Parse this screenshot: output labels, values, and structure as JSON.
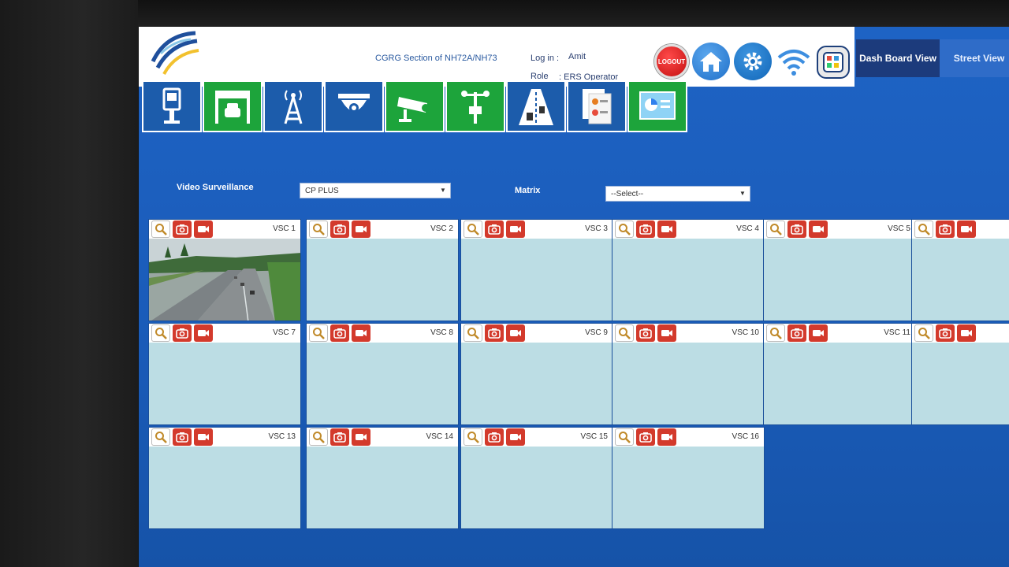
{
  "header": {
    "section_title": "CGRG Section of NH72A/NH73",
    "login_label": "Log in :",
    "login_value": "Amit",
    "role_label": "Role",
    "role_value": ": ERS Operator",
    "logout_label": "LOGOUT",
    "tabs": [
      {
        "label": "Dash Board View",
        "active": true
      },
      {
        "label": "Street View",
        "active": false
      }
    ]
  },
  "toolbar": {
    "items": [
      {
        "icon": "kiosk-icon",
        "color": "blue"
      },
      {
        "icon": "toll-gate-car-icon",
        "color": "green"
      },
      {
        "icon": "radio-tower-icon",
        "color": "blue"
      },
      {
        "icon": "dome-camera-icon",
        "color": "blue"
      },
      {
        "icon": "cctv-camera-icon",
        "color": "green"
      },
      {
        "icon": "weather-station-icon",
        "color": "green"
      },
      {
        "icon": "highway-traffic-icon",
        "color": "blue"
      },
      {
        "icon": "report-documents-icon",
        "color": "blue"
      },
      {
        "icon": "dashboard-chart-icon",
        "color": "green"
      }
    ]
  },
  "filters": {
    "video_label": "Video Surveillance",
    "video_value": "CP PLUS",
    "matrix_label": "Matrix",
    "matrix_value": "--Select--"
  },
  "cameras": [
    {
      "label": "VSC 1",
      "has_feed": true
    },
    {
      "label": "VSC 2"
    },
    {
      "label": "VSC 3"
    },
    {
      "label": "VSC 4"
    },
    {
      "label": "VSC 5"
    },
    {
      "label": ""
    },
    {
      "label": "VSC 7"
    },
    {
      "label": "VSC 8"
    },
    {
      "label": "VSC 9"
    },
    {
      "label": "VSC 10"
    },
    {
      "label": "VSC 11"
    },
    {
      "label": ""
    },
    {
      "label": "VSC 13"
    },
    {
      "label": "VSC 14"
    },
    {
      "label": "VSC 15"
    },
    {
      "label": "VSC 16"
    }
  ],
  "colors": {
    "screen_bg": "#1a5bb8",
    "toolbar_blue": "#1c5cab",
    "toolbar_green": "#1da43b",
    "cell_bg": "#bcdde4",
    "action_red": "#d33a2c"
  }
}
